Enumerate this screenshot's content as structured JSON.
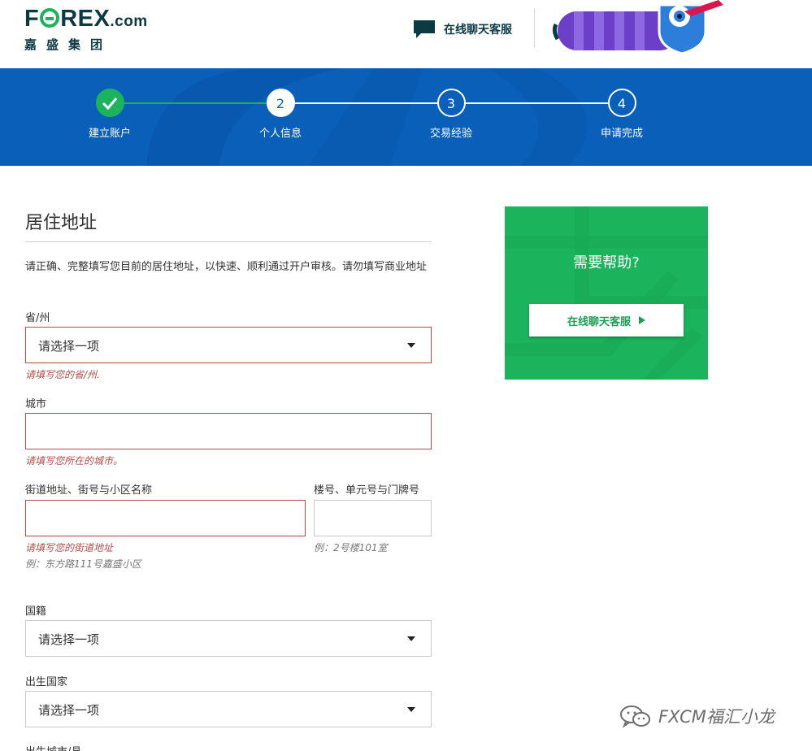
{
  "header": {
    "logo_text": "FOREX",
    "logo_domain": ".com",
    "logo_sub": "嘉盛集团",
    "chat_label": "在线聊天客服"
  },
  "progress": {
    "steps": [
      {
        "number": "",
        "label": "建立账户",
        "state": "done"
      },
      {
        "number": "2",
        "label": "个人信息",
        "state": "current"
      },
      {
        "number": "3",
        "label": "交易经验",
        "state": "todo"
      },
      {
        "number": "4",
        "label": "申请完成",
        "state": "todo"
      }
    ]
  },
  "form": {
    "section_title": "居住地址",
    "intro": "请正确、完整填写您目前的居住地址，以快速、顺利通过开户审核。请勿填写商业地址",
    "province": {
      "label": "省/州",
      "value": "请选择一项",
      "error": "请填写您的省/州."
    },
    "city": {
      "label": "城市",
      "value": "",
      "error": "请填写您所在的城市。"
    },
    "street": {
      "label": "街道地址、街号与小区名称",
      "value": "",
      "error": "请填写您的街道地址",
      "hint": "例：东方路111号嘉盛小区"
    },
    "building": {
      "label": "楼号、单元号与门牌号",
      "value": "",
      "hint": "例：2号楼101室"
    },
    "nationality": {
      "label": "国籍",
      "value": "请选择一项"
    },
    "birth_country": {
      "label": "出生国家",
      "value": "请选择一项"
    },
    "birth_city": {
      "label": "出生城市/县"
    }
  },
  "help": {
    "title": "需要帮助?",
    "button_label": "在线聊天客服"
  },
  "watermark": {
    "text": "FXCM福汇小龙"
  },
  "colors": {
    "brand_blue": "#0a5fb8",
    "brand_green": "#1bb35c",
    "error": "#b44b4b",
    "logo_dark": "#0c3a44"
  }
}
